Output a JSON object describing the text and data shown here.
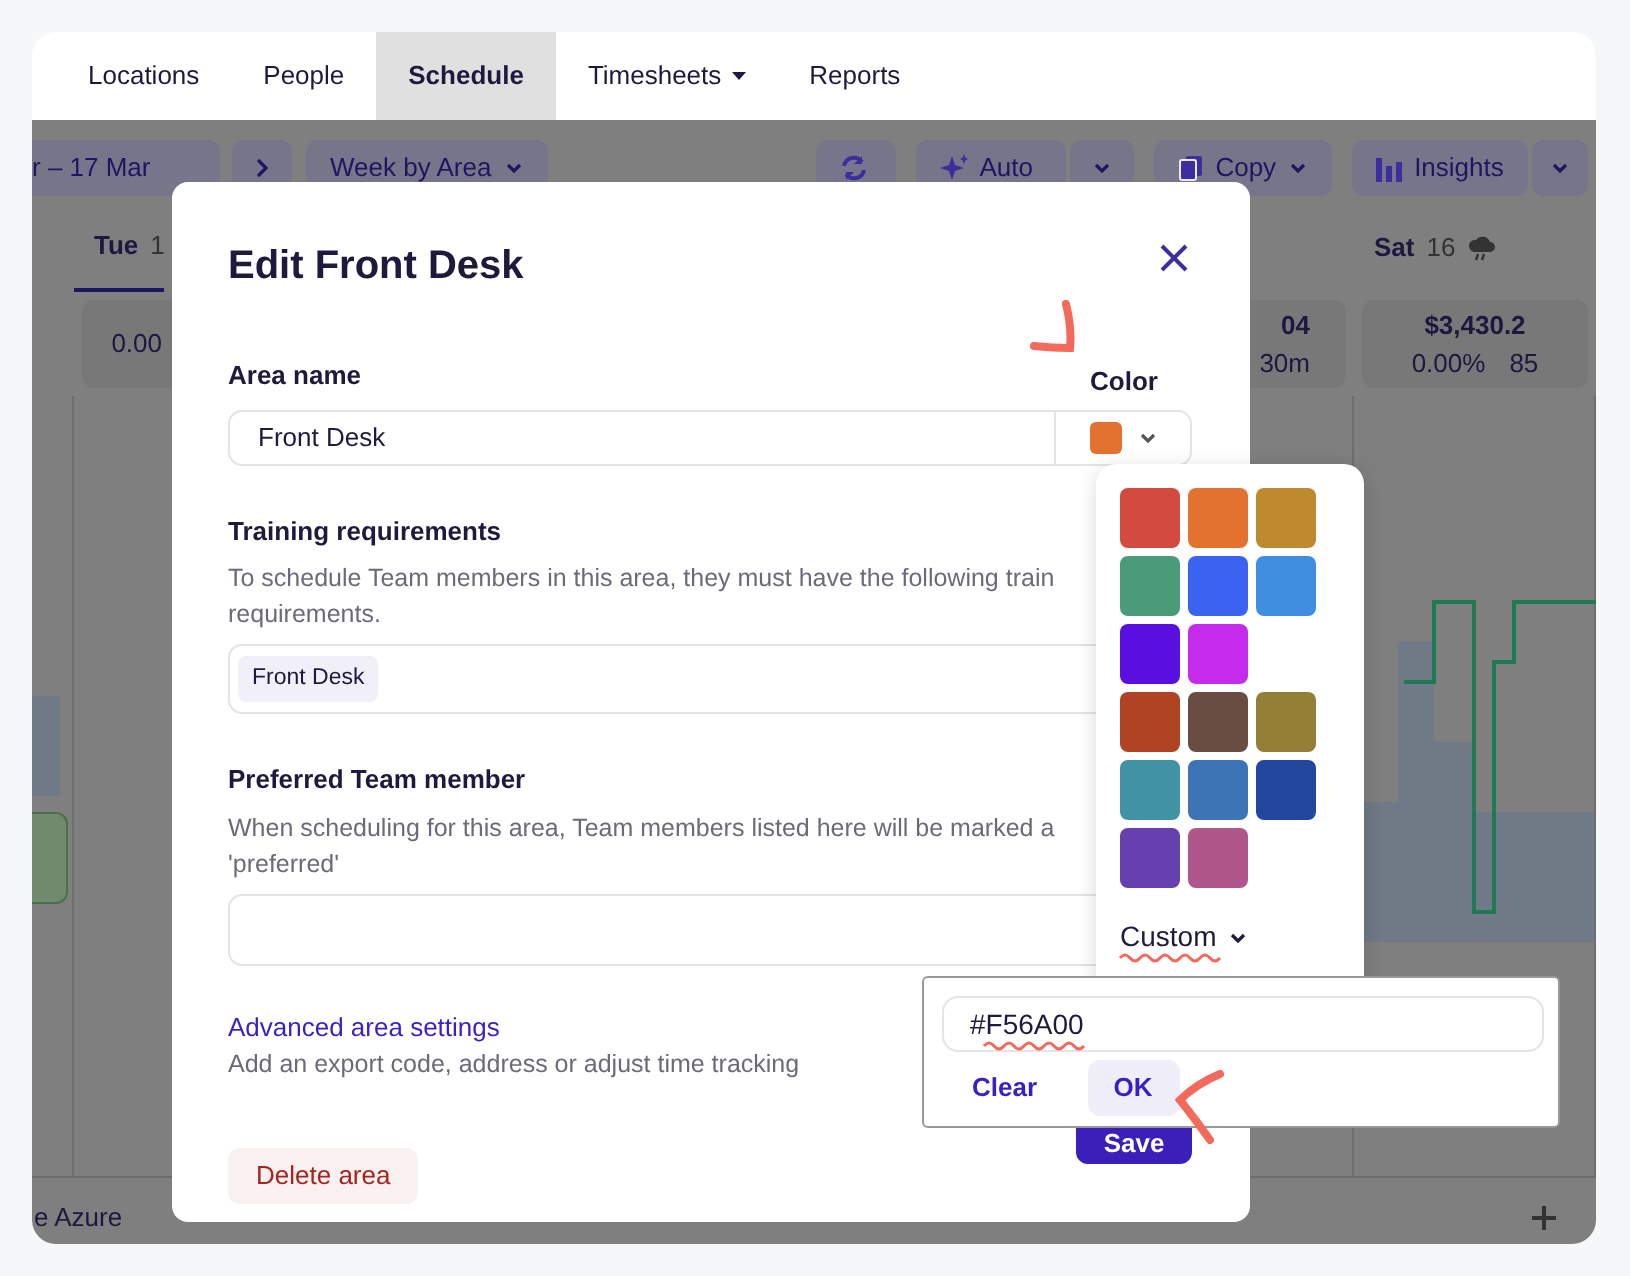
{
  "nav": {
    "tabs": [
      {
        "label": "Locations",
        "selected": false,
        "has_menu": false
      },
      {
        "label": "People",
        "selected": false,
        "has_menu": false
      },
      {
        "label": "Schedule",
        "selected": true,
        "has_menu": false
      },
      {
        "label": "Timesheets",
        "selected": false,
        "has_menu": true
      },
      {
        "label": "Reports",
        "selected": false,
        "has_menu": false
      }
    ]
  },
  "toolbar": {
    "date_range": "r – 17 Mar",
    "view": "Week by Area",
    "auto": "Auto",
    "copy": "Copy",
    "insights": "Insights"
  },
  "columns": [
    {
      "day": "Tue",
      "date": "1",
      "selected": true,
      "weather_icon": false,
      "stat_lines": [
        [
          "0.00"
        ]
      ]
    },
    {},
    {},
    {
      "stat_lines": [
        [
          "04"
        ],
        [
          "30m"
        ]
      ]
    },
    {
      "day": "Sat",
      "date": "16",
      "selected": false,
      "weather_icon": true,
      "stat_lines": [
        [
          "$3,430.2"
        ],
        [
          "0.00%",
          "85"
        ]
      ]
    }
  ],
  "area_row": {
    "label": "e Azure"
  },
  "modal": {
    "title": "Edit Front Desk",
    "area_name": {
      "label": "Area name",
      "value": "Front Desk"
    },
    "color": {
      "label": "Color",
      "color": "#e37230"
    },
    "training": {
      "label": "Training requirements",
      "help_lines": [
        "To schedule Team members in this area, they must have the following train",
        "requirements."
      ],
      "tags": [
        "Front Desk"
      ]
    },
    "preferred": {
      "label": "Preferred Team member",
      "help_lines": [
        "When scheduling for this area, Team members listed here will be marked a",
        "'preferred'"
      ]
    },
    "advanced": {
      "link": "Advanced area settings",
      "help": "Add an export code, address or adjust time tracking"
    },
    "delete": "Delete area",
    "save": "Save"
  },
  "color_picker": {
    "rows": [
      [
        {
          "color": "#d34a3f"
        },
        {
          "color": "#e37230"
        },
        {
          "color": "#bf8a2f"
        }
      ],
      [
        {
          "color": "#4a9b7a"
        },
        {
          "color": "#3a63f2"
        },
        {
          "color": "#3f8ee0"
        }
      ],
      [
        {
          "color": "#5a0fe0"
        },
        {
          "color": "#c52bea"
        }
      ],
      [
        {
          "color": "#b04322"
        },
        {
          "color": "#694d42"
        },
        {
          "color": "#947f36"
        }
      ],
      [
        {
          "color": "#4292a6"
        },
        {
          "color": "#3c74b6"
        },
        {
          "color": "#21489c"
        }
      ],
      [
        {
          "color": "#6540ae"
        },
        {
          "color": "#af578a"
        }
      ]
    ],
    "custom": "Custom"
  },
  "custom_color": {
    "value": "#F56A00",
    "clear": "Clear",
    "ok": "OK"
  }
}
